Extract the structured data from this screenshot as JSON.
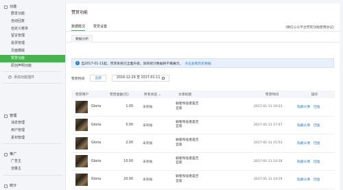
{
  "sidebar": {
    "function_head": "功能",
    "function_items": [
      "群发功能",
      "自动回复",
      "自定义菜单",
      "留言管理",
      "投票管理",
      "页面模版",
      "赞赏功能",
      "原创声明功能"
    ],
    "active_index": 6,
    "add_plugin": "添加功能插件",
    "manage_head": "管理",
    "manage_items": [
      "消息管理",
      "用户管理",
      "素材管理"
    ],
    "promo_head": "推广",
    "promo_items": [
      "广告主",
      "流量主"
    ],
    "stats_head": "统计"
  },
  "main": {
    "title": "赞赏功能",
    "tabs": [
      "数据概况",
      "赞赏设置"
    ],
    "top_link": "(微信公众平台赞赏功能使用协议)",
    "subtabs": [
      "数据分析",
      "数据流水"
    ],
    "notice_text": "自2017-01-11起，赞赏系统已全面升级，旧的统计数据将不再展示。",
    "notice_link": "点击查看历史数据",
    "filter_label": "赞赏时间",
    "filter_all": "全部",
    "date_range": "2016-12-29 至 2017-01-11"
  },
  "table": {
    "headers": [
      "赞赏用户",
      "赞赏金额(元)",
      "所有状态 ⌄",
      "文章标题",
      "赞赏时间",
      "操作"
    ],
    "rows": [
      {
        "user": "Gloria",
        "amount": "1.00",
        "status": "未到账",
        "title": "弱者和强者是否\n宜家",
        "time": "2017-01-11 19:23",
        "op1": "隐藏头像",
        "op2": "回复"
      },
      {
        "user": "Gloria",
        "amount": "5.00",
        "status": "未到账",
        "title": "弱者和强者是否\n宜家",
        "time": "2017-01-11 17:47",
        "op1": "隐藏头像",
        "op2": "回复"
      },
      {
        "user": "Gloria",
        "amount": "2.00",
        "status": "未到账",
        "title": "弱者和强者是否\n宜家",
        "time": "2017-01-11 15:53",
        "op1": "隐藏头像",
        "op2": "回复"
      },
      {
        "user": "Gloria",
        "amount": "10.00",
        "status": "未到账",
        "title": "弱者和强者是否\n宜家",
        "time": "2017-01-11 14:28",
        "op1": "隐藏头像",
        "op2": "回复"
      },
      {
        "user": "Gloria",
        "amount": "20.00",
        "status": "未到账",
        "title": "弱者和强者是否\n宜家",
        "time": "2017-01-11 14:19",
        "op1": "隐藏头像",
        "op2": "回复"
      }
    ]
  },
  "colors": {
    "accent": "#44b549",
    "link": "#2f7fd5"
  }
}
